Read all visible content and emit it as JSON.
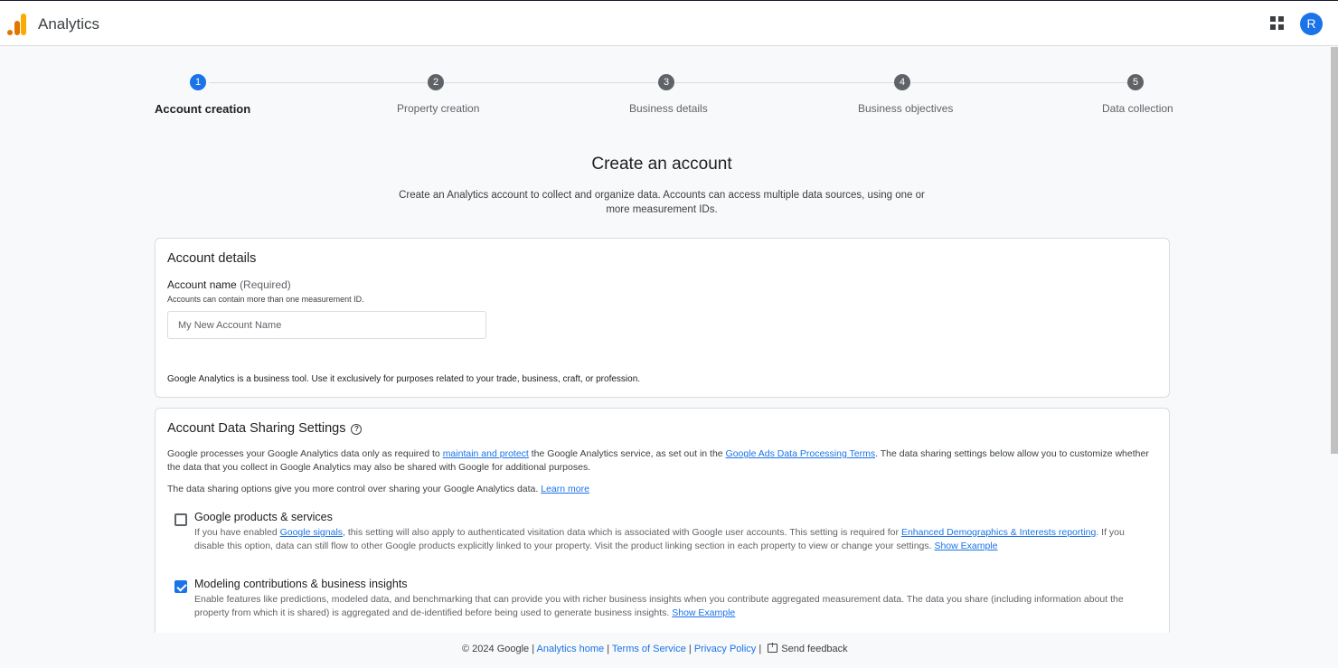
{
  "header": {
    "app_title": "Analytics",
    "apps_icon": "apps-grid-icon",
    "avatar_letter": "R",
    "accent_color": "#1a73e8"
  },
  "stepper": {
    "steps": [
      {
        "number": "1",
        "label": "Account creation",
        "active": true
      },
      {
        "number": "2",
        "label": "Property creation",
        "active": false
      },
      {
        "number": "3",
        "label": "Business details",
        "active": false
      },
      {
        "number": "4",
        "label": "Business objectives",
        "active": false
      },
      {
        "number": "5",
        "label": "Data collection",
        "active": false
      }
    ]
  },
  "main": {
    "title": "Create an account",
    "subtitle": "Create an Analytics account to collect and organize data. Accounts can access multiple data sources, using one or more measurement IDs."
  },
  "account_details": {
    "title": "Account details",
    "field_label": "Account name",
    "field_required": "(Required)",
    "field_hint": "Accounts can contain more than one measurement ID.",
    "field_placeholder": "My New Account Name",
    "field_value": "",
    "business_note": "Google Analytics is a business tool. Use it exclusively for purposes related to your trade, business, craft, or profession."
  },
  "data_sharing": {
    "title": "Account Data Sharing Settings",
    "help_icon": "help-circle-icon",
    "intro_part1": "Google processes your Google Analytics data only as required to ",
    "intro_link1": "maintain and protect",
    "intro_part2": " the Google Analytics service, as set out in the ",
    "intro_link2": "Google Ads Data Processing Terms",
    "intro_part3": ". The data sharing settings below allow you to customize whether the data that you collect in Google Analytics may also be shared with Google for additional purposes.",
    "control_text": "The data sharing options give you more control over sharing your Google Analytics data. ",
    "learn_more": "Learn more",
    "options": [
      {
        "title": "Google products & services",
        "checked": false,
        "desc_part1": "If you have enabled ",
        "desc_link1": "Google signals",
        "desc_part2": ", this setting will also apply to authenticated visitation data which is associated with Google user accounts. This setting is required for ",
        "desc_link2": "Enhanced Demographics & Interests reporting",
        "desc_part3": ". If you disable this option, data can still flow to other Google products explicitly linked to your property. Visit the product linking section in each property to view or change your settings. ",
        "show_example": "Show Example"
      },
      {
        "title": "Modeling contributions & business insights",
        "checked": true,
        "desc_part1": "Enable features like predictions, modeled data, and benchmarking that can provide you with richer business insights when you contribute aggregated measurement data. The data you share (including information about the property from which it is shared) is aggregated and de-identified before being used to generate business insights. ",
        "show_example": "Show Example"
      }
    ]
  },
  "footer": {
    "copyright": "© 2024 Google",
    "analytics_home": "Analytics home",
    "terms": "Terms of Service",
    "privacy": "Privacy Policy",
    "feedback_icon": "feedback-icon",
    "send_feedback": "Send feedback"
  }
}
